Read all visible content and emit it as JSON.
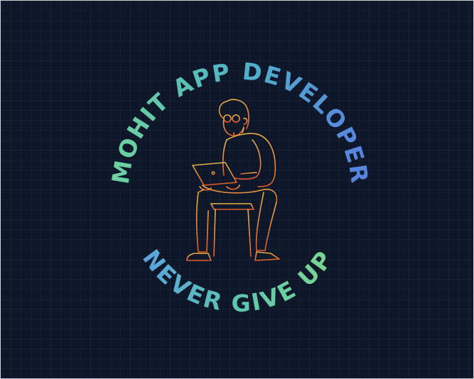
{
  "logo": {
    "top_text": "MOHIT APP DEVELOPER",
    "bottom_text": "NEVER GIVE UP",
    "figure": "man-sitting-with-laptop-icon",
    "colors": {
      "background": "#0e172a",
      "text_gradient_start": "#6fd49a",
      "text_gradient_mid": "#4fb3b8",
      "text_gradient_end": "#5a7fe0",
      "figure_gradient_top": "#e8b048",
      "figure_gradient_bottom": "#e0602a"
    }
  }
}
